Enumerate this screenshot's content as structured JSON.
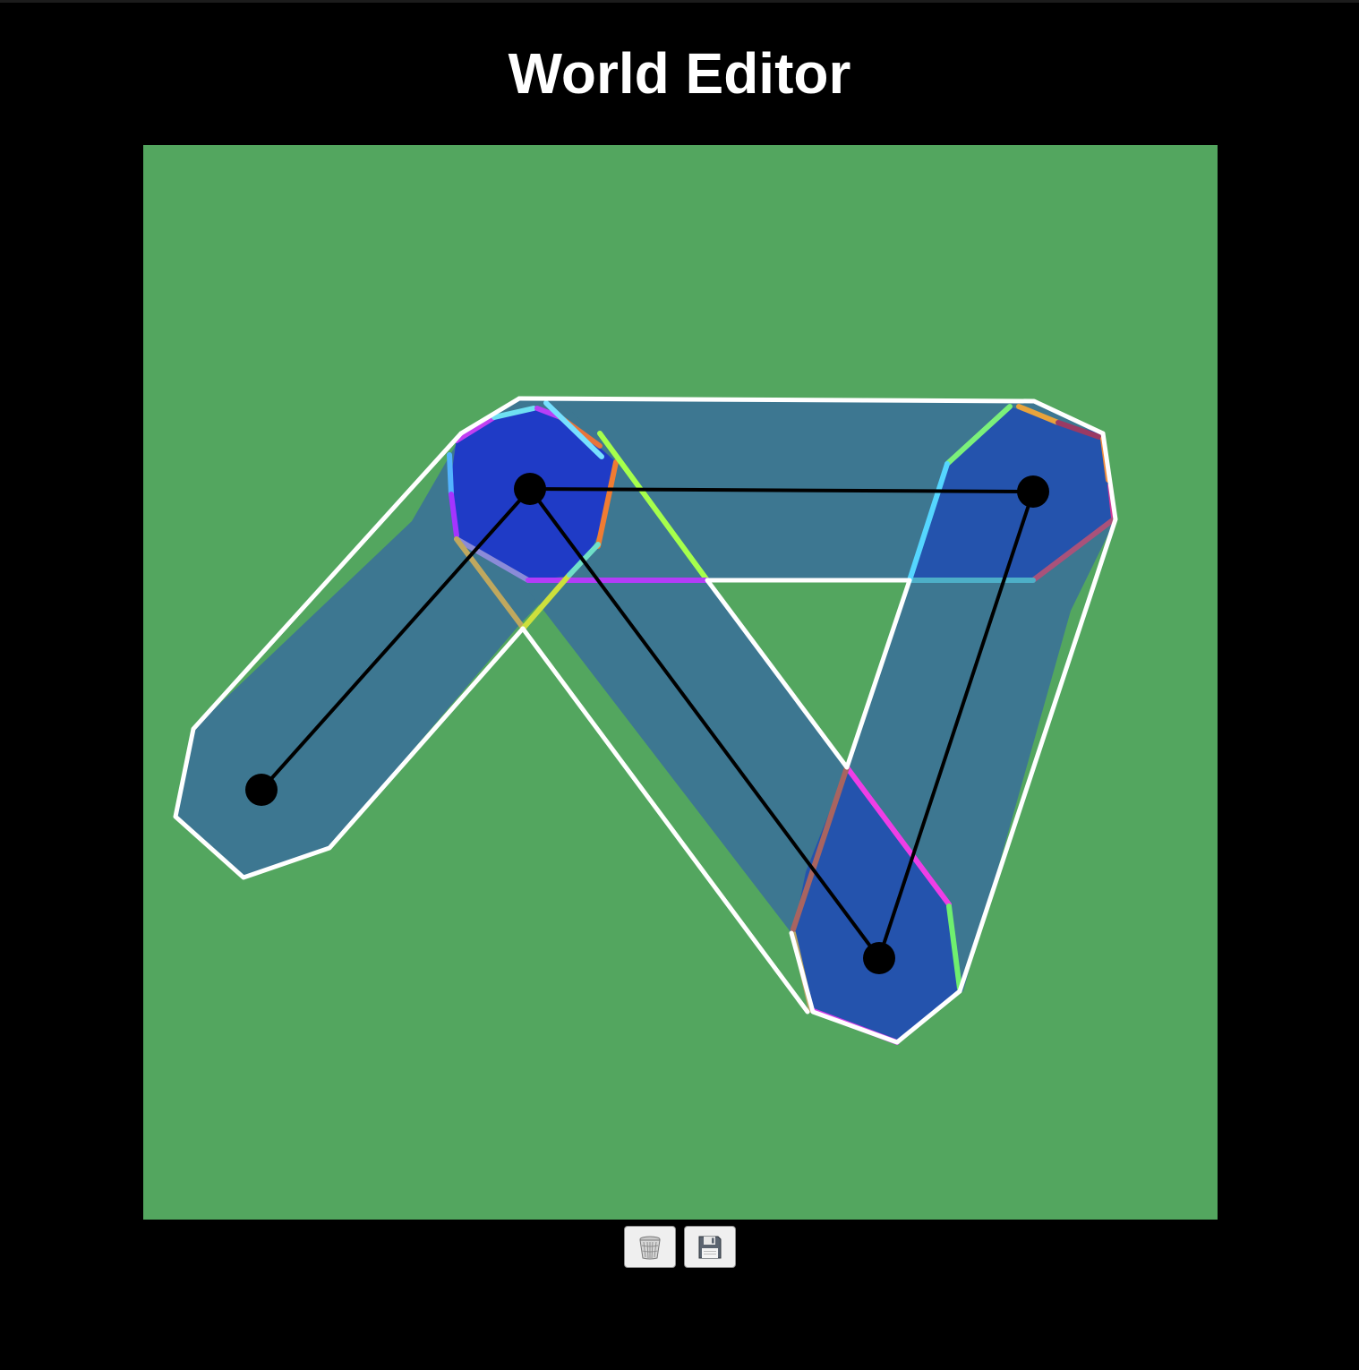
{
  "header": {
    "title": "World Editor"
  },
  "canvas": {
    "background": "#53a65f",
    "road_fill": "#3d7791",
    "intersection_fill": "#2453ad",
    "intersection_fill_highlight": "#1f3bc6",
    "border_color": "#ffffff",
    "graph_color": "#000000"
  },
  "controls": {
    "dispose_icon": "trash-icon",
    "save_icon": "floppy-disk-icon"
  }
}
